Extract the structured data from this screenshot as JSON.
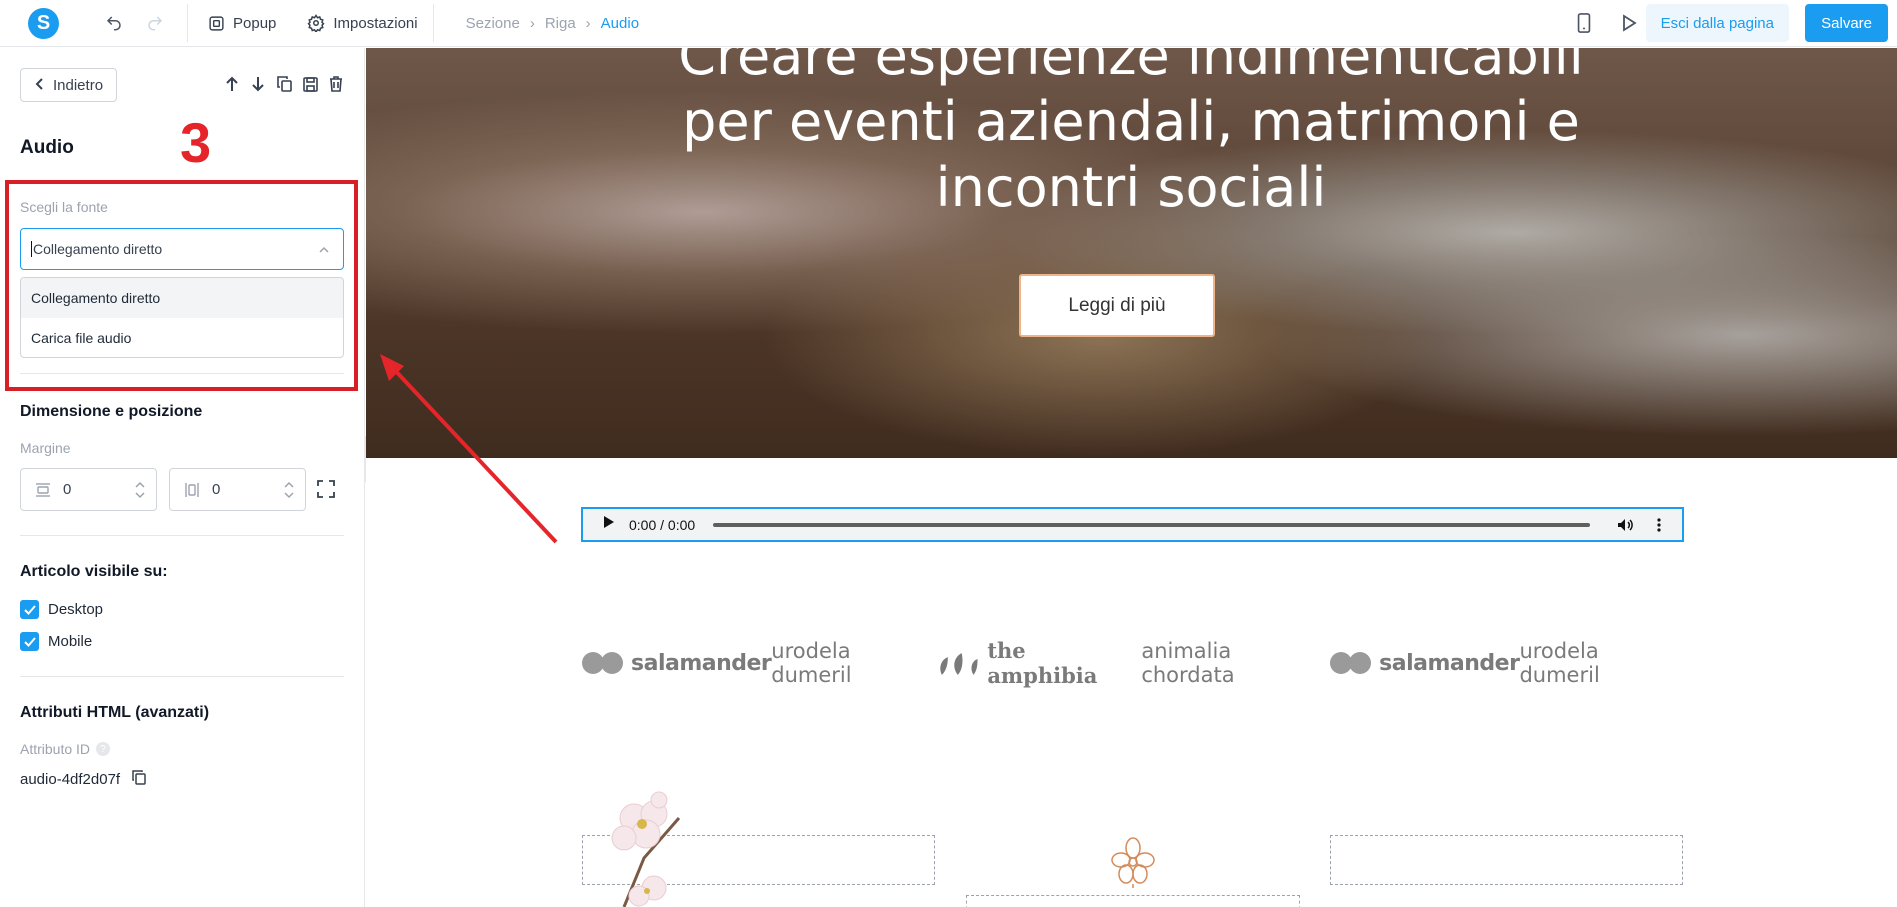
{
  "topbar": {
    "logo_letter": "S",
    "popup_label": "Popup",
    "settings_label": "Impostazioni",
    "breadcrumb": [
      "Sezione",
      "Riga",
      "Audio"
    ],
    "exit_label": "Esci dalla pagina",
    "save_label": "Salvare"
  },
  "sidebar": {
    "back_label": "Indietro",
    "panel_title": "Audio",
    "step_number": "3",
    "source_label": "Scegli la fonte",
    "source_value": "Collegamento diretto",
    "source_options": [
      "Collegamento diretto",
      "Carica file audio"
    ],
    "size_section": "Dimensione e posizione",
    "margin_label": "Margine",
    "margin_h": "0",
    "margin_v": "0",
    "visible_section": "Articolo visibile su:",
    "visible_options": [
      {
        "label": "Desktop",
        "checked": true
      },
      {
        "label": "Mobile",
        "checked": true
      }
    ],
    "html_section": "Attributi HTML (avanzati)",
    "id_label": "Attributo ID",
    "id_value": "audio-4df2d07f"
  },
  "canvas": {
    "hero_title": "Creare esperienze indimenticabili per eventi aziendali, matrimoni e incontri sociali",
    "hero_button": "Leggi di più",
    "audio_time": "0:00 / 0:00",
    "logos": [
      {
        "text": "salamander",
        "style": "bold"
      },
      {
        "text": "urodela dumeril",
        "style": "light"
      },
      {
        "text": "the amphibia",
        "style": "serif"
      },
      {
        "text": "animalia chordata",
        "style": "light"
      },
      {
        "text": "salamander",
        "style": "bold"
      },
      {
        "text": "urodela dumeril",
        "style": "light"
      }
    ]
  },
  "colors": {
    "accent": "#1a9cf0",
    "annotation_red": "#d91f26"
  }
}
